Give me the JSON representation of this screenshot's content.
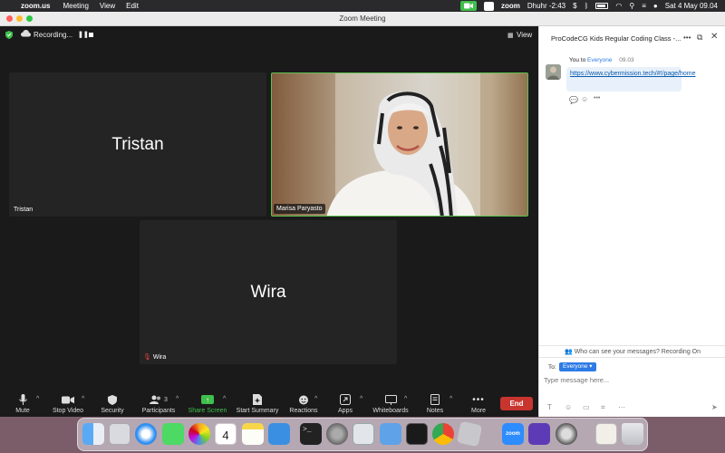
{
  "menubar": {
    "app": "zoom.us",
    "items": [
      "Meeting",
      "View",
      "Edit"
    ],
    "zoom_status": "zoom",
    "prayer": "Dhuhr -2:43",
    "datetime": "Sat 4 May  09.04"
  },
  "window": {
    "title": "Zoom Meeting"
  },
  "meeting": {
    "recording_label": "Recording...",
    "view_label": "View",
    "tiles": [
      {
        "big_name": "Tristan",
        "label": "Tristan"
      },
      {
        "big_name": "",
        "label": "Marisa Paryasto"
      },
      {
        "big_name": "Wira",
        "label": "Wira"
      }
    ]
  },
  "toolbar": {
    "mute": "Mute",
    "stop_video": "Stop Video",
    "security": "Security",
    "participants": "Participants",
    "participants_count": "3",
    "share_screen": "Share Screen",
    "start_summary": "Start Summary",
    "reactions": "Reactions",
    "apps": "Apps",
    "whiteboards": "Whiteboards",
    "notes": "Notes",
    "more": "More",
    "end": "End"
  },
  "chat": {
    "title": "ProCodeCG Kids Regular Coding Class -...",
    "message": {
      "from": "You to ",
      "to": "Everyone",
      "time": "09.03",
      "link": "https://www.cybermission.tech/#!/page/home"
    },
    "who_can_see": "Who can see your messages? Recording On",
    "to_label": "To:",
    "recipient": "Everyone",
    "placeholder": "Type message here..."
  },
  "colors": {
    "end_button": "#c8352e",
    "active_speaker_border": "#5dc24f",
    "share_green": "#3fbf4c",
    "link_blue": "#0b5cad"
  }
}
